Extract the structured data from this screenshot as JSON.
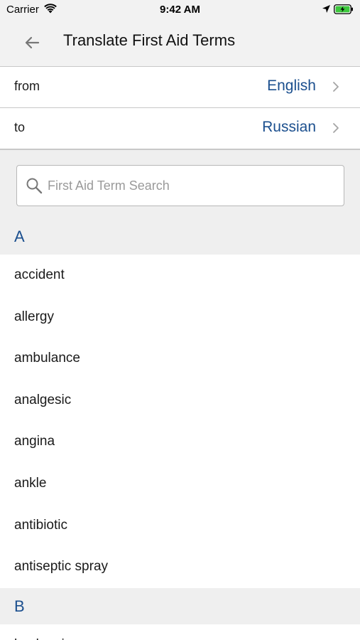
{
  "status_bar": {
    "carrier": "Carrier",
    "time": "9:42 AM"
  },
  "nav": {
    "title": "Translate First Aid Terms"
  },
  "from_row": {
    "label": "from",
    "value": "English"
  },
  "to_row": {
    "label": "to",
    "value": "Russian"
  },
  "search": {
    "placeholder": "First Aid Term Search",
    "value": ""
  },
  "sections": [
    {
      "letter": "A",
      "terms": [
        "accident",
        "allergy",
        "ambulance",
        "analgesic",
        "angina",
        "ankle",
        "antibiotic",
        "antiseptic spray"
      ]
    },
    {
      "letter": "B",
      "terms": [
        "back pain"
      ]
    }
  ],
  "colors": {
    "accent": "#1b4f8e",
    "background_gray": "#efefef",
    "battery_green": "#3cc83c"
  }
}
